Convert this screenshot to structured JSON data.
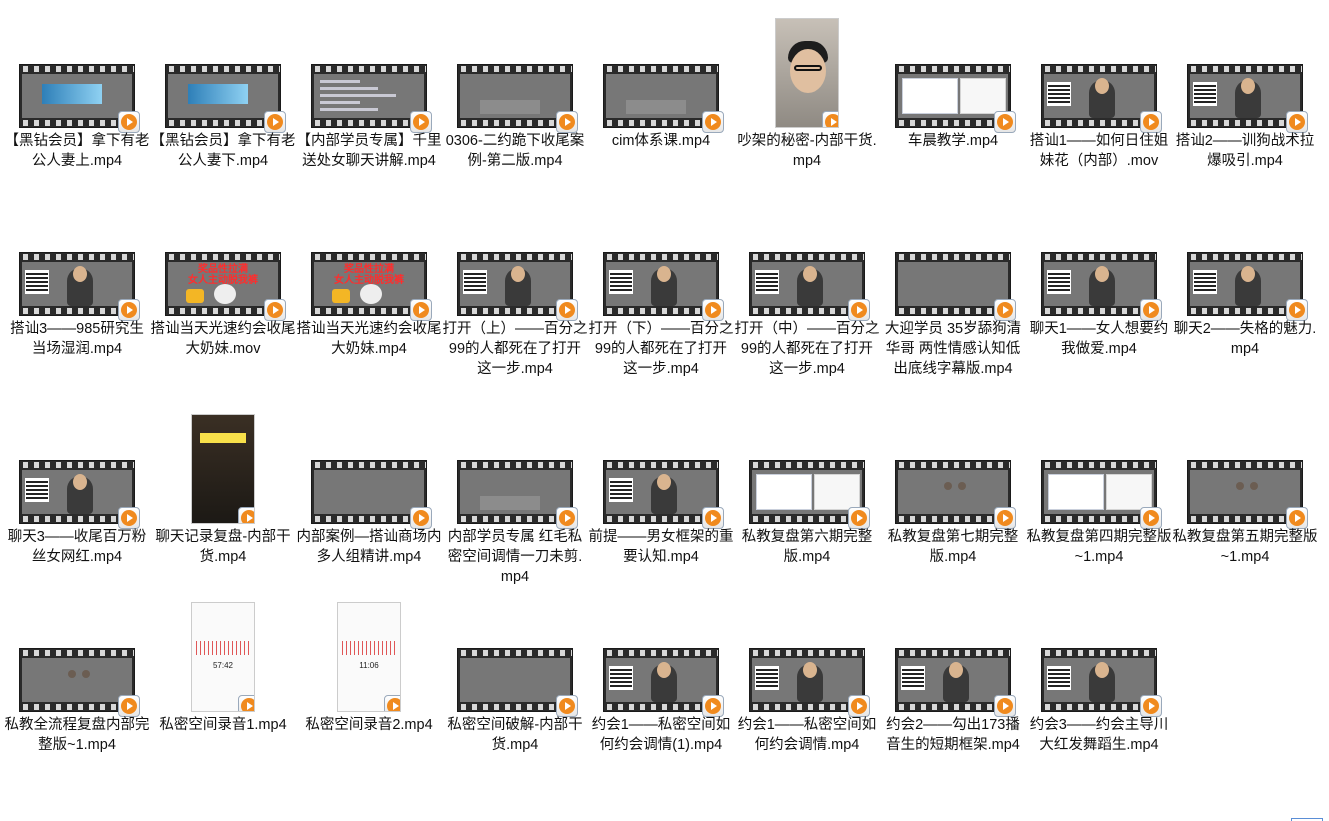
{
  "files": [
    {
      "name": "【黑钻会员】拿下有老公人妻上.mp4",
      "thumb": "subway",
      "kind": "film"
    },
    {
      "name": "【黑钻会员】拿下有老公人妻下.mp4",
      "thumb": "subway",
      "kind": "film"
    },
    {
      "name": "【内部学员专属】千里送处女聊天讲解.mp4",
      "thumb": "doc",
      "kind": "film"
    },
    {
      "name": "0306-二约跪下收尾案例-第二版.mp4",
      "thumb": "office",
      "kind": "film"
    },
    {
      "name": "cim体系课.mp4",
      "thumb": "office",
      "kind": "film"
    },
    {
      "name": "吵架的秘密-内部干货.mp4",
      "thumb": "face",
      "kind": "portrait"
    },
    {
      "name": "车晨教学.mp4",
      "thumb": "screen",
      "kind": "film"
    },
    {
      "name": "搭讪1——如何日住姐妹花（内部）.mov",
      "thumb": "room",
      "kind": "film"
    },
    {
      "name": "搭讪2——训狗战术拉爆吸引.mp4",
      "thumb": "room",
      "kind": "film"
    },
    {
      "name": "搭讪3——985研究生当场湿润.mp4",
      "thumb": "room",
      "kind": "film"
    },
    {
      "name": "搭讪当天光速约会收尾大奶妹.mov",
      "thumb": "meme",
      "kind": "film"
    },
    {
      "name": "搭讪当天光速约会收尾大奶妹.mp4",
      "thumb": "meme",
      "kind": "film"
    },
    {
      "name": "打开（上）——百分之99的人都死在了打开这一步.mp4",
      "thumb": "room",
      "kind": "film"
    },
    {
      "name": "打开（下）——百分之99的人都死在了打开这一步.mp4",
      "thumb": "room",
      "kind": "film"
    },
    {
      "name": "打开（中）——百分之99的人都死在了打开这一步.mp4",
      "thumb": "room",
      "kind": "film"
    },
    {
      "name": "大迎学员 35岁舔狗清华哥 两性情感认知低出底线字幕版.mp4",
      "thumb": "colorful",
      "kind": "film"
    },
    {
      "name": "聊天1——女人想要约我做爱.mp4",
      "thumb": "room",
      "kind": "film"
    },
    {
      "name": "聊天2——失格的魅力.mp4",
      "thumb": "room",
      "kind": "film"
    },
    {
      "name": "聊天3——收尾百万粉丝女网红.mp4",
      "thumb": "room",
      "kind": "film"
    },
    {
      "name": "聊天记录复盘-内部干货.mp4",
      "thumb": "chatshot",
      "kind": "portrait"
    },
    {
      "name": "内部案例—搭讪商场内多人组精讲.mp4",
      "thumb": "dark",
      "kind": "film"
    },
    {
      "name": "内部学员专属 红毛私密空间调情一刀未剪.mp4",
      "thumb": "office",
      "kind": "film"
    },
    {
      "name": "前提——男女框架的重要认知.mp4",
      "thumb": "room",
      "kind": "film"
    },
    {
      "name": "私教复盘第六期完整版.mp4",
      "thumb": "screen",
      "kind": "film"
    },
    {
      "name": "私教复盘第七期完整版.mp4",
      "thumb": "white",
      "kind": "film"
    },
    {
      "name": "私教复盘第四期完整版~1.mp4",
      "thumb": "screen",
      "kind": "film"
    },
    {
      "name": "私教复盘第五期完整版~1.mp4",
      "thumb": "white",
      "kind": "film"
    },
    {
      "name": "私教全流程复盘内部完整版~1.mp4",
      "thumb": "white",
      "kind": "film"
    },
    {
      "name": "私密空间录音1.mp4",
      "thumb": "recorder",
      "kind": "portrait",
      "timer": "57:42"
    },
    {
      "name": "私密空间录音2.mp4",
      "thumb": "recorder",
      "kind": "portrait",
      "timer": "11:06"
    },
    {
      "name": "私密空间破解-内部干货.mp4",
      "thumb": "dark",
      "kind": "film"
    },
    {
      "name": "约会1——私密空间如何约会调情(1).mp4",
      "thumb": "room",
      "kind": "film"
    },
    {
      "name": "约会1——私密空间如何约会调情.mp4",
      "thumb": "room",
      "kind": "film"
    },
    {
      "name": "约会2——勾出173播音生的短期框架.mp4",
      "thumb": "room",
      "kind": "film"
    },
    {
      "name": "约会3——约会主导川大红发舞蹈生.mp4",
      "thumb": "room",
      "kind": "film"
    }
  ],
  "meme_text": "奖品性拉满\n女人主动脱我裤",
  "colors": {
    "play_badge": "#f08a1e",
    "film": "#2a2a2a"
  }
}
